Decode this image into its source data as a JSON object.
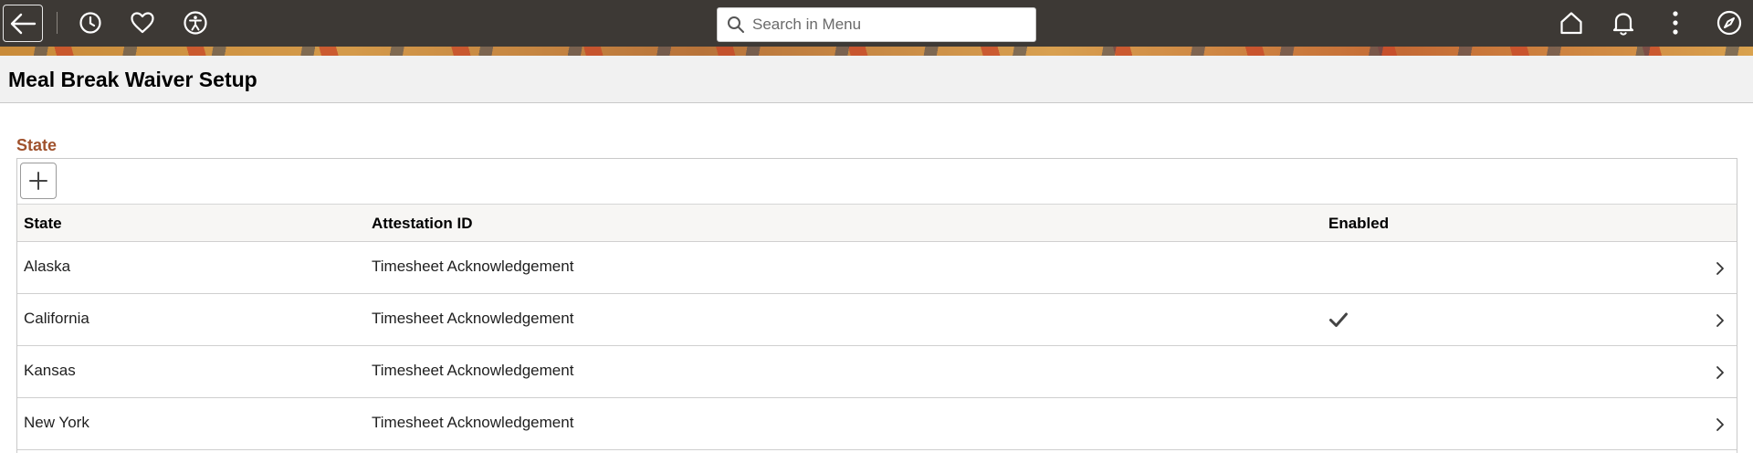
{
  "header": {
    "search": {
      "placeholder": "Search in Menu",
      "value": ""
    },
    "icons": {
      "back": "back-arrow-icon",
      "recent": "clock-icon",
      "favorites": "heart-icon",
      "accessibility": "accessibility-icon",
      "home": "home-icon",
      "notifications": "bell-icon",
      "actions": "kebab-menu-icon",
      "navigator": "compass-icon"
    },
    "colors": {
      "bar": "#3d3935",
      "icon": "#ffffff"
    }
  },
  "page": {
    "title": "Meal Break Waiver Setup"
  },
  "grid": {
    "section_label": "State",
    "section_label_color": "#a0522d",
    "columns": [
      "State",
      "Attestation ID",
      "Enabled"
    ],
    "rows": [
      {
        "state": "Alaska",
        "attestation_id": "Timesheet Acknowledgement",
        "enabled": false
      },
      {
        "state": "California",
        "attestation_id": "Timesheet Acknowledgement",
        "enabled": true
      },
      {
        "state": "Kansas",
        "attestation_id": "Timesheet Acknowledgement",
        "enabled": false
      },
      {
        "state": "New York",
        "attestation_id": "Timesheet Acknowledgement",
        "enabled": false
      }
    ]
  }
}
